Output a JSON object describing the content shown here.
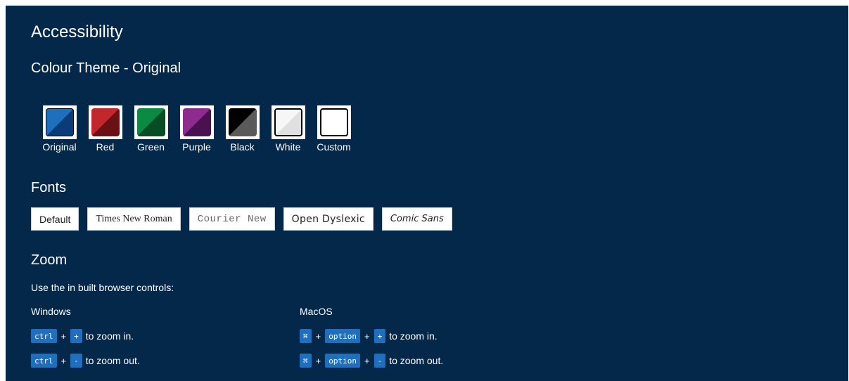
{
  "title": "Accessibility",
  "theme": {
    "heading": "Colour Theme - Original",
    "swatches": [
      {
        "label": "Original",
        "c1": "#1f6fbf",
        "c2": "#0b3c7a"
      },
      {
        "label": "Red",
        "c1": "#c1272d",
        "c2": "#6b1014"
      },
      {
        "label": "Green",
        "c1": "#0b8a43",
        "c2": "#064d26"
      },
      {
        "label": "Purple",
        "c1": "#8e2b8f",
        "c2": "#4a1150"
      },
      {
        "label": "Black",
        "c1": "#000000",
        "c2": "#5a5a5a"
      },
      {
        "label": "White",
        "c1": "#f3f3f3",
        "c2": "#e2e2e2"
      },
      {
        "label": "Custom",
        "c1": "#ffffff",
        "c2": "#ffffff"
      }
    ]
  },
  "fonts": {
    "heading": "Fonts",
    "buttons": [
      "Default",
      "Times New Roman",
      "Courier New",
      "Open Dyslexic",
      "Comic Sans"
    ]
  },
  "zoom": {
    "heading": "Zoom",
    "description": "Use the in built browser controls:",
    "windows": {
      "label": "Windows",
      "zoom_in": {
        "keys": [
          "ctrl",
          "+"
        ],
        "text": "to zoom in."
      },
      "zoom_out": {
        "keys": [
          "ctrl",
          "-"
        ],
        "text": "to zoom out."
      }
    },
    "macos": {
      "label": "MacOS",
      "zoom_in": {
        "keys": [
          "⌘",
          "option",
          "+"
        ],
        "text": "to zoom in."
      },
      "zoom_out": {
        "keys": [
          "⌘",
          "option",
          "-"
        ],
        "text": "to zoom out."
      }
    }
  },
  "colors": {
    "background": "#04284a",
    "key": "#1f6fbf"
  }
}
